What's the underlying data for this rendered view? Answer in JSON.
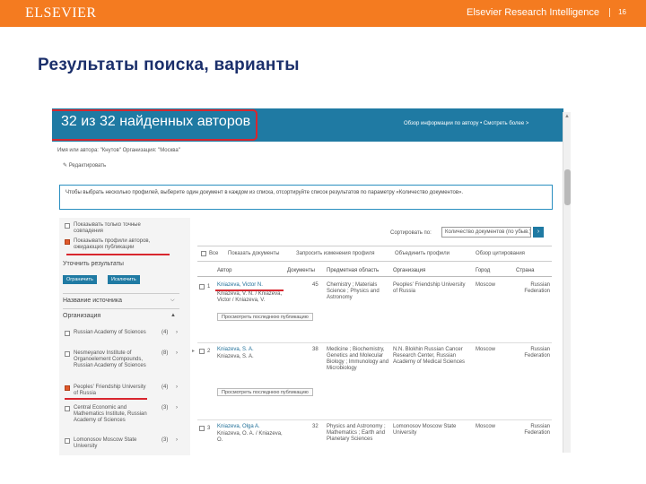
{
  "header": {
    "logo": "ELSEVIER",
    "brand": "Elsevier Research Intelligence",
    "page_number": "16",
    "bar_color": "#f47b20"
  },
  "slide_title": "Результаты поиска, варианты",
  "search": {
    "result_title": "32 из 32 найденных авторов",
    "compare_link": "Обзор информации по автору • Смотреть более >",
    "breadcrumb": "Имя или автора: \"Кнутов\"  Организация: \"Москва\"",
    "edit_link": "✎ Редактировать",
    "notice": "Чтобы выбрать несколько профилей, выберите один документ в каждом из списка, отсортируйте список результатов по параметру «Количество документов»."
  },
  "filters": {
    "show_exact": "Показывать только точные совпадения",
    "show_pending": "Показывать профили авторов, ожидающих публикации",
    "refine_label": "Уточнить результаты",
    "limit_button": "Ограничить",
    "exclude_button": "Исключить",
    "source_title_label": "Название источника",
    "affiliation_label": "Организация",
    "items": [
      {
        "label": "Russian Academy of Sciences",
        "count": "(4)",
        "checked": false
      },
      {
        "label": "Nesmeyanov Institute of Organoelement Compounds, Russian Academy of Sciences",
        "count": "(8)",
        "checked": false
      },
      {
        "label": "Peoples' Friendship University of Russia",
        "count": "(4)",
        "checked": true
      },
      {
        "label": "Central Economic and Mathematics Institute, Russian Academy of Sciences",
        "count": "(3)",
        "checked": false
      },
      {
        "label": "Lomonosov Moscow State University",
        "count": "(3)",
        "checked": false
      }
    ]
  },
  "results": {
    "sort_label": "Сортировать по:",
    "sort_value": "Количество документов (по убыв.)",
    "toolbar": {
      "all_label": "Все",
      "show_docs": "Показать документы",
      "feedback": "Запросить изменения профиля",
      "request_merge": "Объединить профили",
      "view_citation": "Обзор цитирования"
    },
    "columns": [
      "Автор",
      "Документы",
      "Предметная область",
      "Организация",
      "Город",
      "Страна"
    ],
    "rows": [
      {
        "num": "1",
        "author": "Kniazeva, Victor N.",
        "alt_names": "Kniazeva, V. N. / Kniazeva, Victor / Kniazeva, V.",
        "docs": "45",
        "subjects": "Chemistry ; Materials Science ; Physics and Astronomy",
        "affiliation": "Peoples' Friendship University of Russia",
        "city": "Moscow",
        "country": "Russian Federation",
        "recent_button": "Просмотреть последнюю публикацию"
      },
      {
        "num": "2",
        "author": "Kniazeva, S. A.",
        "alt_names": "Kniazeva, S. A.",
        "docs": "38",
        "subjects": "Medicine ; Biochemistry, Genetics and Molecular Biology ; Immunology and Microbiology",
        "affiliation": "N.N. Blokhin Russian Cancer Research Center, Russian Academy of Medical Sciences",
        "city": "Moscow",
        "country": "Russian Federation",
        "recent_button": "Просмотреть последнюю публикацию"
      },
      {
        "num": "3",
        "author": "Kniazeva, Olga A.",
        "alt_names": "Kniazeva, O. A. / Kniazeva, O.",
        "docs": "32",
        "subjects": "Physics and Astronomy ; Mathematics ; Earth and Planetary Sciences",
        "affiliation": "Lomonosov Moscow State University",
        "city": "Moscow",
        "country": "Russian Federation",
        "recent_button": ""
      }
    ]
  },
  "colors": {
    "accent_blue": "#1f7aa3",
    "highlight_red": "#d8262e",
    "title_navy": "#1b2f6b"
  }
}
